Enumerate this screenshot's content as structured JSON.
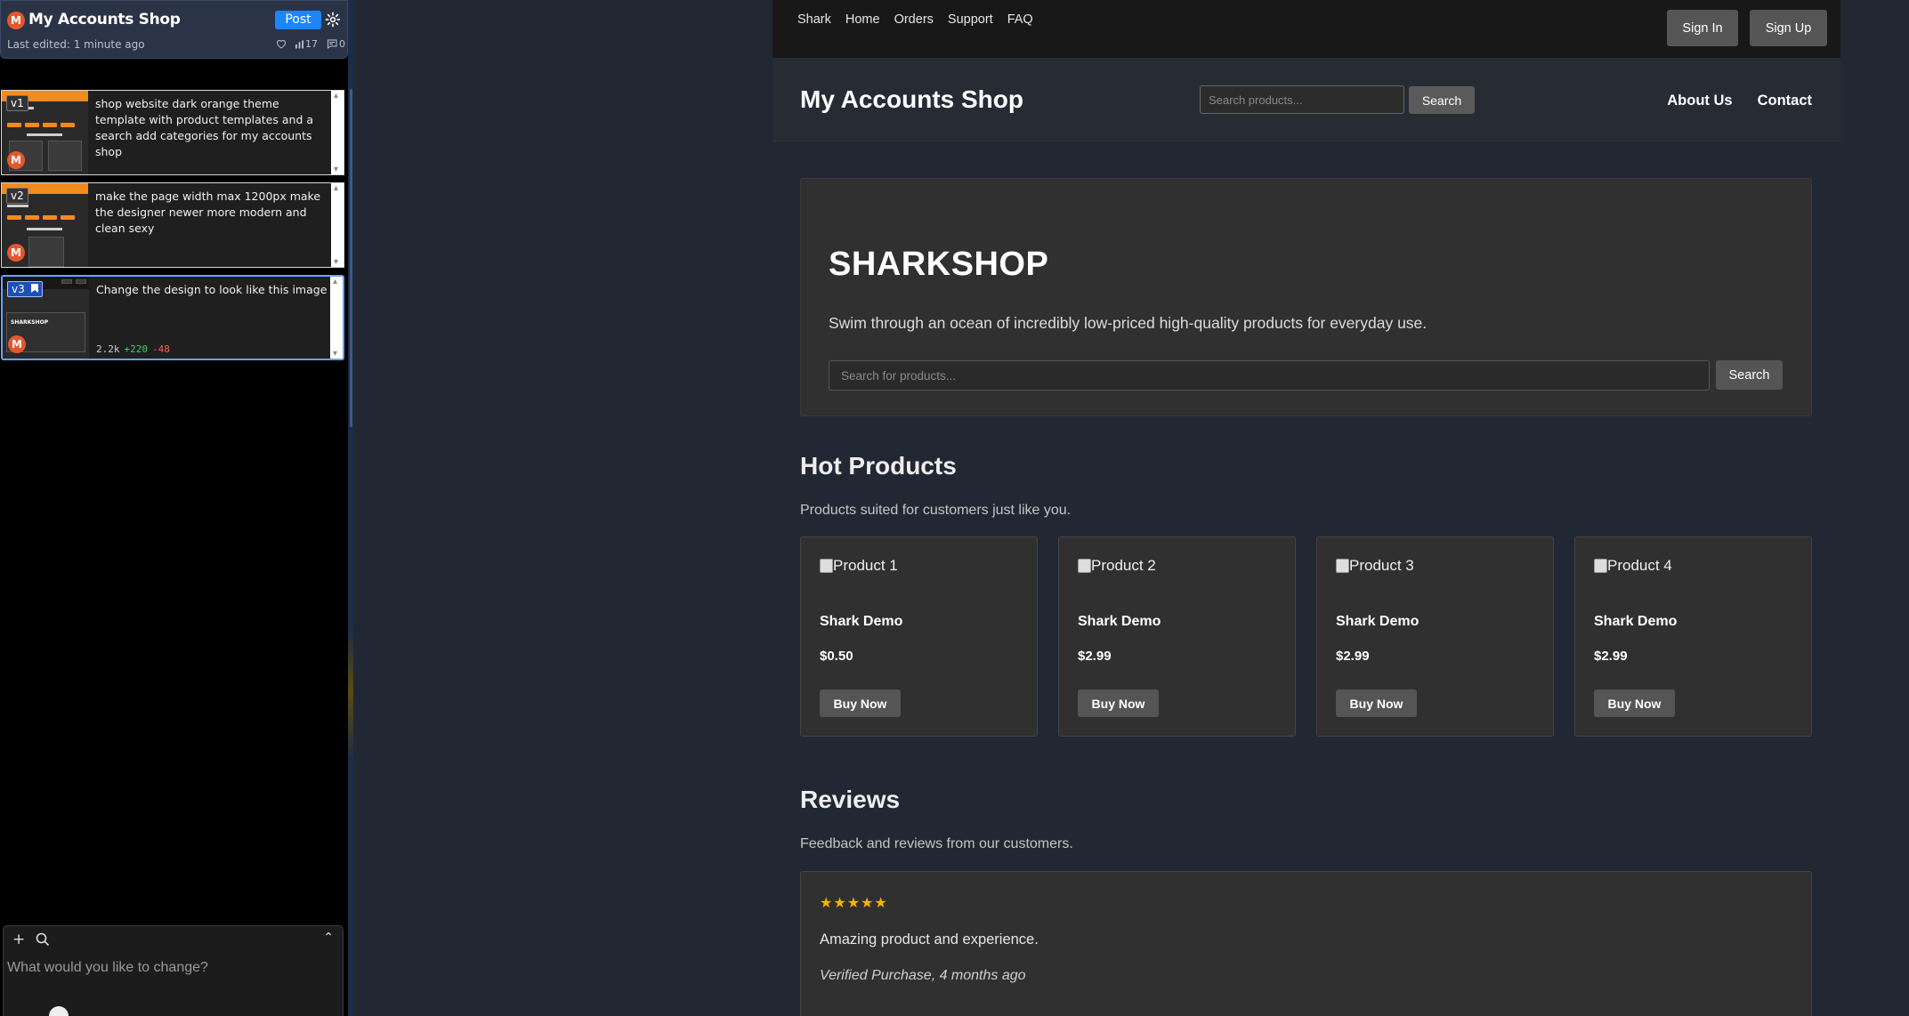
{
  "app": {
    "project_title": "My Accounts Shop",
    "avatar_letter": "M",
    "post_label": "Post",
    "last_edited": "Last edited: 1 minute ago",
    "views": "17",
    "comments": "0"
  },
  "versions": [
    {
      "tag": "v1",
      "prompt": "shop website dark orange theme template with product templates and a search add categories for my accounts shop"
    },
    {
      "tag": "v2",
      "prompt": "make the page width max 1200px make the designer newer more modern and clean sexy"
    },
    {
      "tag": "v3",
      "prompt": "Change the design to look like this image",
      "thumb_title": "SHARKSHOP",
      "diff_size": "2.2k",
      "diff_added": "+220",
      "diff_removed": "-48"
    }
  ],
  "chat": {
    "placeholder": "What would you like to change?"
  },
  "site": {
    "nav_links": [
      "Shark",
      "Home",
      "Orders",
      "Support",
      "FAQ"
    ],
    "sign_in": "Sign In",
    "sign_up": "Sign Up",
    "brand": "My Accounts Shop",
    "header_search_placeholder": "Search products...",
    "header_search_button": "Search",
    "header_links": [
      "About Us",
      "Contact"
    ],
    "hero": {
      "title": "SHARKSHOP",
      "subtitle": "Swim through an ocean of incredibly low-priced high-quality products for everyday use.",
      "search_placeholder": "Search for products...",
      "search_button": "Search"
    },
    "hot": {
      "title": "Hot Products",
      "subtitle": "Products suited for customers just like you.",
      "products": [
        {
          "img_alt": "Product 1",
          "name": "Shark Demo",
          "price": "$0.50",
          "button": "Buy Now"
        },
        {
          "img_alt": "Product 2",
          "name": "Shark Demo",
          "price": "$2.99",
          "button": "Buy Now"
        },
        {
          "img_alt": "Product 3",
          "name": "Shark Demo",
          "price": "$2.99",
          "button": "Buy Now"
        },
        {
          "img_alt": "Product 4",
          "name": "Shark Demo",
          "price": "$2.99",
          "button": "Buy Now"
        }
      ]
    },
    "reviews": {
      "title": "Reviews",
      "subtitle": "Feedback and reviews from our customers.",
      "items": [
        {
          "stars": "★★★★★",
          "text": "Amazing product and experience.",
          "meta": "Verified Purchase, 4 months ago"
        }
      ]
    }
  },
  "colors": {
    "accent_blue": "#1a86ff",
    "avatar_orange": "#e4572e",
    "star_gold": "#f5b400"
  }
}
